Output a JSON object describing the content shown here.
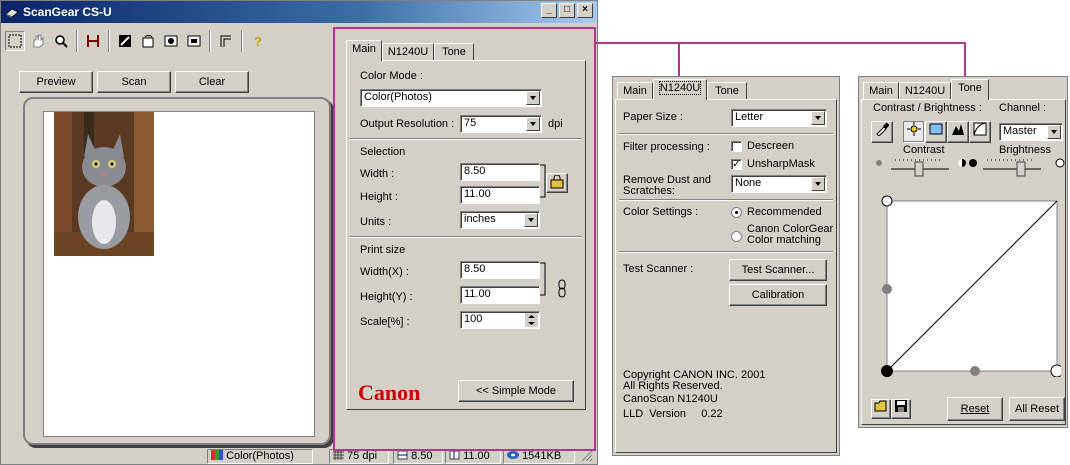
{
  "window": {
    "title": "ScanGear CS-U",
    "controls": [
      "_",
      "□",
      "×"
    ]
  },
  "toolbar": {
    "icons": [
      "marquee-tool-icon",
      "hand-tool-icon",
      "zoom-tool-icon",
      "auto-crop-icon",
      "image-adjust-icon",
      "rotate-left-icon",
      "rotate-right-icon",
      "mirror-icon",
      "crop-corner-icon",
      "help-icon"
    ]
  },
  "actions": {
    "preview": "Preview",
    "scan": "Scan",
    "clear": "Clear"
  },
  "status": {
    "mode": "Color(Photos)",
    "resolution": "75 dpi",
    "width": "8.50",
    "height": "11.00",
    "size": "1541KB"
  },
  "main_tab": {
    "tabs": [
      "Main",
      "N1240U",
      "Tone"
    ],
    "color_mode_label": "Color Mode :",
    "color_mode_value": "Color(Photos)",
    "output_res_label": "Output Resolution :",
    "output_res_value": "75",
    "dpi": "dpi",
    "selection_label": "Selection",
    "width_label": "Width :",
    "width_value": "8.50",
    "height_label": "Height :",
    "height_value": "11.00",
    "units_label": "Units :",
    "units_value": "inches",
    "print_size_label": "Print size",
    "print_width_label": "Width(X) :",
    "print_width_value": "8.50",
    "print_height_label": "Height(Y) :",
    "print_height_value": "11.00",
    "scale_label": "Scale[%] :",
    "scale_value": "100",
    "brand": "Canon",
    "simple_mode": "<< Simple Mode"
  },
  "n1240u_tab": {
    "tabs": [
      "Main",
      "N1240U",
      "Tone"
    ],
    "paper_size_label": "Paper Size :",
    "paper_size_value": "Letter",
    "filter_label": "Filter processing :",
    "descreen": "Descreen",
    "unsharp": "UnsharpMask",
    "remove_dust_label_1": "Remove Dust and",
    "remove_dust_label_2": "Scratches:",
    "remove_dust_value": "None",
    "color_settings_label": "Color Settings :",
    "recommended": "Recommended",
    "colorgear_1": "Canon ColorGear",
    "colorgear_2": "Color matching",
    "test_scanner_label": "Test Scanner :",
    "test_scanner_btn": "Test Scanner...",
    "calibration_btn": "Calibration",
    "copyright_1": "Copyright CANON INC. 2001",
    "copyright_2": "All Rights Reserved.",
    "copyright_3": "CanoScan N1240U",
    "copyright_4": "LLD  Version     0.22"
  },
  "tone_tab": {
    "tabs": [
      "Main",
      "N1240U",
      "Tone"
    ],
    "contrast_brightness_label": "Contrast / Brightness :",
    "channel_label": "Channel :",
    "channel_value": "Master",
    "contrast": "Contrast",
    "brightness": "Brightness",
    "reset": "Reset",
    "all_reset": "All Reset"
  },
  "colors": {
    "callout": "#b0368e",
    "canon_red": "#cc0000",
    "window_face": "#d4d0c8",
    "title_blue": "#0a246a"
  }
}
